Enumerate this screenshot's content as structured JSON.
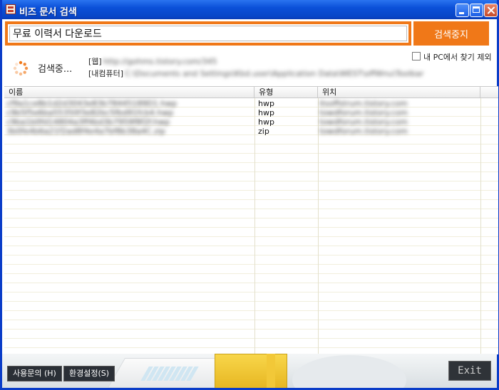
{
  "window": {
    "title": "비즈 문서 검색"
  },
  "search": {
    "query": "무료 이력서 다운로드",
    "stop_button": "검색중지"
  },
  "status": {
    "searching_label": "검색중...",
    "web_label": "[웹]",
    "web_value": "http://gohms.tistory.com/345",
    "mypc_label": "[내컴퓨터]",
    "mypc_value": "C:\\Documents and Settings\\Kbd.user\\Application Data\\WEST\\offWnu\\Toolbar",
    "exclude_my_pc": "내 PC에서 찾기 제외"
  },
  "table": {
    "columns": [
      "이름",
      "유형",
      "위치"
    ],
    "rows": [
      {
        "name": "cf9a1ce8b1d2d3043e83b78445189D1.hwp",
        "type": "hwp",
        "location": "itsoffstrum.tistory.com"
      },
      {
        "name": "c9b5f5e6ba55350f3e82bc5fbd91fcb4.hwp",
        "type": "hwp",
        "location": "towdforum.tistory.com"
      },
      {
        "name": "c9ba1b0fd14804a3ff4bd3b7959f8f2f.hwp",
        "type": "hwp",
        "location": "towdforum.tistory.com"
      },
      {
        "name": "3b0fe4b6a21f2ad8f4e4a7bf8b38a4C.zip",
        "type": "zip",
        "location": "towdforum.tistory.com"
      }
    ]
  },
  "footer": {
    "help": "사용문의 (H)",
    "settings": "환경설정(S)",
    "exit": "Exit"
  },
  "colors": {
    "accent": "#f07818",
    "titlebar": "#0b50d8"
  }
}
